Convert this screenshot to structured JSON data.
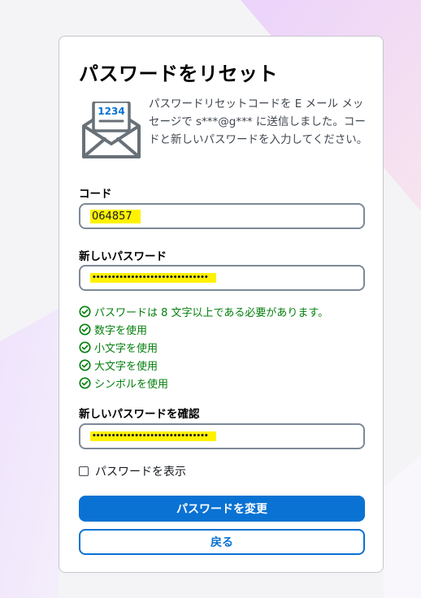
{
  "page": {
    "title": "パスワードをリセット"
  },
  "message": {
    "icon": "envelope-code-icon",
    "code_badge": "1234",
    "text": "パスワードリセットコードを E メール メッセージで s***@g*** に送信しました。コードと新しいパスワードを入力してください。"
  },
  "code": {
    "label": "コード",
    "value": "064857"
  },
  "new_password": {
    "label": "新しいパスワード",
    "value": "••••••••••••••••••••••••••••••"
  },
  "requirements": [
    "パスワードは 8 文字以上である必要があります。",
    "数字を使用",
    "小文字を使用",
    "大文字を使用",
    "シンボルを使用"
  ],
  "confirm_password": {
    "label": "新しいパスワードを確認",
    "value": "••••••••••••••••••••••••••••••"
  },
  "show_password": {
    "label": "パスワードを表示",
    "checked": false
  },
  "buttons": {
    "submit": "パスワードを変更",
    "back": "戻る"
  },
  "colors": {
    "primary": "#0972d3",
    "success": "#037f0c",
    "highlight": "#fff200",
    "border": "#7d8998"
  }
}
